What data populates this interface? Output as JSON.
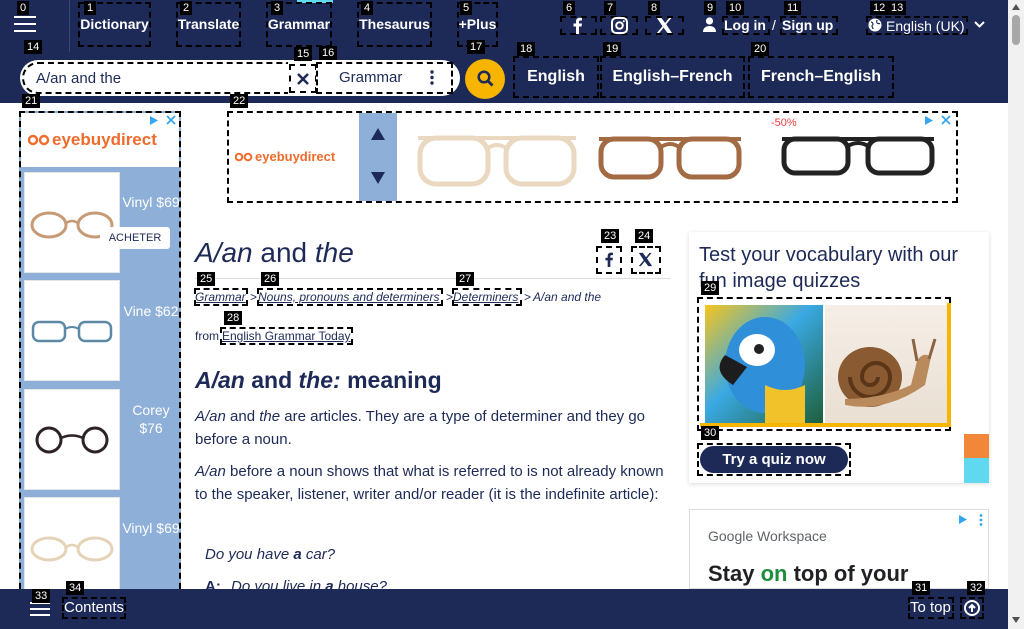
{
  "topnav": {
    "links": [
      "Dictionary",
      "Translate",
      "Grammar",
      "Thesaurus",
      "+Plus"
    ],
    "login": "Log in",
    "slash": "/",
    "signup": "Sign up",
    "language": "English (UK)"
  },
  "search": {
    "value": "A/an and the",
    "dataset": "Grammar",
    "tabs": [
      "English",
      "English–French",
      "French–English"
    ]
  },
  "ads": {
    "side_brand": "eyebuydirect",
    "side_items": [
      {
        "label": "Vinyl $69",
        "cta": "ACHETER"
      },
      {
        "label": "Vine $62"
      },
      {
        "label": "Corey $76"
      },
      {
        "label": "Vinyl $69"
      }
    ],
    "top_brand": "eyebuydirect",
    "top_discount": "-50%",
    "workspace_brand": "Google Workspace",
    "workspace_pre": "Stay ",
    "workspace_hl": "on",
    "workspace_post": " top of your"
  },
  "article": {
    "title_a": "A/an",
    "title_mid": " and ",
    "title_b": "the",
    "breadcrumb": [
      "Grammar",
      "Nouns, pronouns and determiners",
      "Determiners"
    ],
    "breadcrumb_current": "A/an and the",
    "sep": ">",
    "from_label": "from",
    "from_link": "English Grammar Today",
    "h2_a": "A/an",
    "h2_and": " and ",
    "h2_b": "the:",
    "h2_rest": " meaning",
    "p1_a": "A/an",
    "p1_mid": " and ",
    "p1_b": "the",
    "p1_rest": " are articles. They are a type of determiner and they go before a noun.",
    "p2_a": "A/an",
    "p2_rest": " before a noun shows that what is referred to is not already known to the speaker, listener, writer and/or reader (it is the indefinite article):",
    "ex1_pre": "Do you have ",
    "ex1_b": "a",
    "ex1_post": " car?",
    "ex2_speaker": "A:",
    "ex2_pre": "Do you live in ",
    "ex2_b": "a",
    "ex2_post": " house?"
  },
  "quiz": {
    "heading": "Test your vocabulary with our fun image quizzes",
    "button": "Try a quiz now"
  },
  "bottombar": {
    "contents": "Contents",
    "totop": "To top"
  },
  "tags": [
    "0",
    "1",
    "2",
    "3",
    "4",
    "5",
    "6",
    "7",
    "8",
    "9",
    "10",
    "11",
    "12",
    "13",
    "14",
    "15",
    "16",
    "17",
    "18",
    "19",
    "20",
    "21",
    "22",
    "23",
    "24",
    "25",
    "26",
    "27",
    "28",
    "29",
    "30",
    "31",
    "32",
    "33",
    "34"
  ],
  "colors": {
    "navy": "#1d2a57",
    "accent": "#f7b500",
    "cyan": "#60d8f0",
    "orange": "#f2873a",
    "adblue": "#8dafd8"
  },
  "icons": [
    "menu-icon",
    "facebook-icon",
    "instagram-icon",
    "x-icon",
    "user-icon",
    "globe-icon",
    "chevron-down-icon",
    "close-icon",
    "dots-vertical-icon",
    "search-icon",
    "arrow-up-icon",
    "arrow-down-icon",
    "ad-choices-icon",
    "ad-close-icon",
    "arrow-up-circle-icon"
  ]
}
